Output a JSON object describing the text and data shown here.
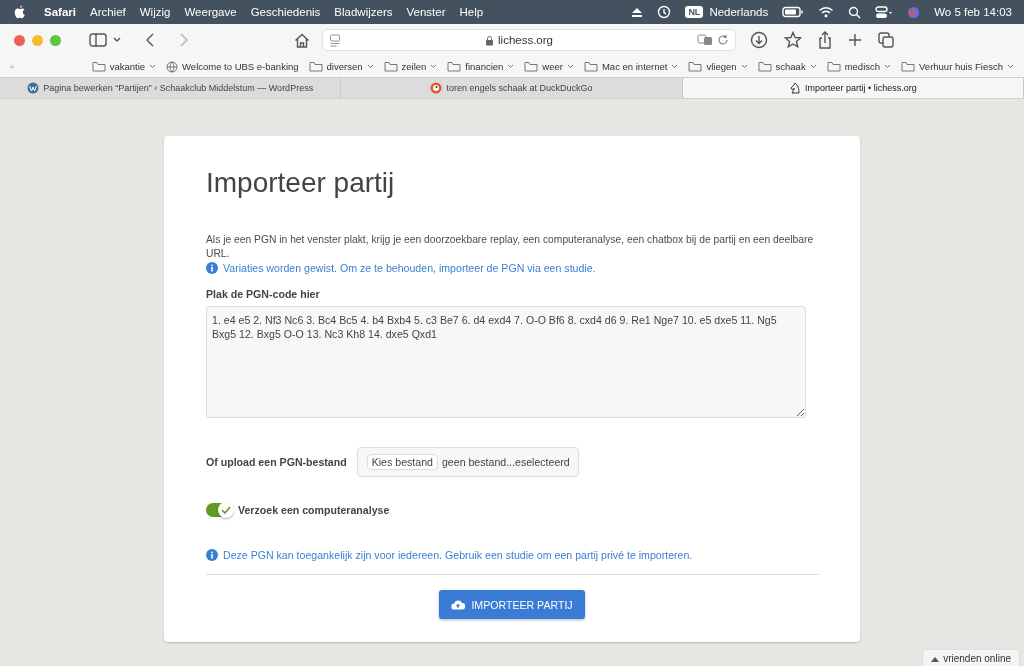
{
  "menubar": {
    "app": "Safari",
    "items": [
      "Archief",
      "Wijzig",
      "Weergave",
      "Geschiedenis",
      "Bladwijzers",
      "Venster",
      "Help"
    ],
    "lang_badge": "NL",
    "language": "Nederlands",
    "clock": "Wo 5 feb  14:03"
  },
  "toolbar": {
    "url": "lichess.org"
  },
  "bookmarks": [
    {
      "kind": "folder",
      "label": "vakantie"
    },
    {
      "kind": "globe",
      "label": "Welcome to UBS e-banking"
    },
    {
      "kind": "folder",
      "label": "diversen"
    },
    {
      "kind": "folder",
      "label": "zeilen"
    },
    {
      "kind": "folder",
      "label": "financien"
    },
    {
      "kind": "folder",
      "label": "weer"
    },
    {
      "kind": "folder",
      "label": "Mac en internet"
    },
    {
      "kind": "folder",
      "label": "vliegen"
    },
    {
      "kind": "folder",
      "label": "schaak"
    },
    {
      "kind": "folder",
      "label": "medisch"
    },
    {
      "kind": "folder",
      "label": "Verhuur huis Fiesch"
    }
  ],
  "tabs": [
    {
      "title": "Pagina bewerken “Partijen” ‹ Schaakclub Middelstum — WordPress",
      "kind": "wordpress",
      "selected": false
    },
    {
      "title": "toren engels schaak at DuckDuckGo",
      "kind": "duck",
      "selected": false
    },
    {
      "title": "Importeer partij • lichess.org",
      "kind": "knight",
      "selected": true
    }
  ],
  "page": {
    "title": "Importeer partij",
    "intro": "Als je een PGN in het venster plakt, krijg je een doorzoekbare replay, een computeranalyse, een chatbox bij de partij en een deelbare URL.",
    "variations_notice": "Variaties worden gewist. Om ze te behouden, importeer de PGN via een studie.",
    "pgn_label": "Plak de PGN-code hier",
    "pgn_value": "1. e4 e5 2. Nf3 Nc6 3. Bc4 Bc5 4. b4 Bxb4 5. c3 Be7 6. d4 exd4 7. O-O Bf6 8. cxd4 d6 9. Re1 Nge7 10. e5 dxe5 11. Ng5 Bxg5 12. Bxg5 O-O 13. Nc3 Kh8 14. dxe5 Qxd1",
    "upload_label": "Of upload een PGN-bestand",
    "file_button": "Kies bestand",
    "file_status": "geen bestand...eselecteerd",
    "analysis": {
      "label": "Verzoek een computeranalyse",
      "on": true
    },
    "privacy_notice": "Deze PGN kan toegankelijk zijn voor iedereen. Gebruik een studie om een partij privé te importeren.",
    "submit": "IMPORTEER PARTIJ"
  },
  "friends": "vrienden online"
}
